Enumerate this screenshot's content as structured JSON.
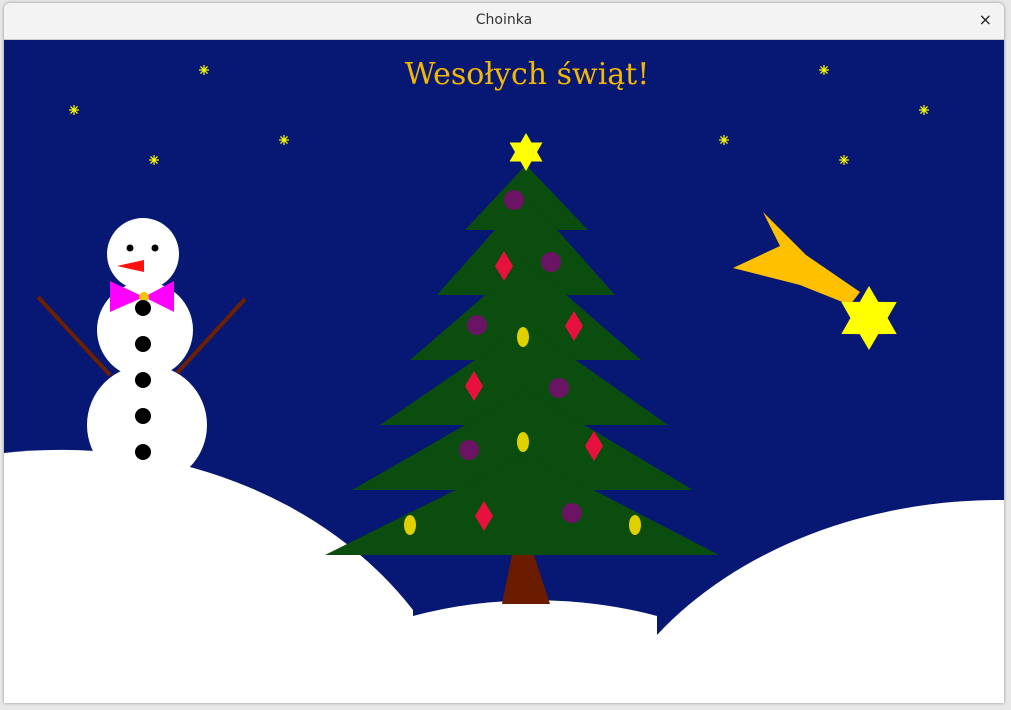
{
  "window": {
    "title": "Choinka",
    "close_label": "×"
  },
  "scene": {
    "greeting": "Wesołych świąt!",
    "colors": {
      "sky": "#071874",
      "snow": "#ffffff",
      "tree": "#0b4d0f",
      "trunk": "#6b1c00",
      "text": "#f5b800",
      "star": "#ffff00",
      "comet_tail": "#ffc000",
      "ornament_purple": "#6b1464",
      "ornament_yellow": "#e0d000",
      "ornament_red": "#e8103c",
      "bow": "#ff00ff"
    }
  }
}
